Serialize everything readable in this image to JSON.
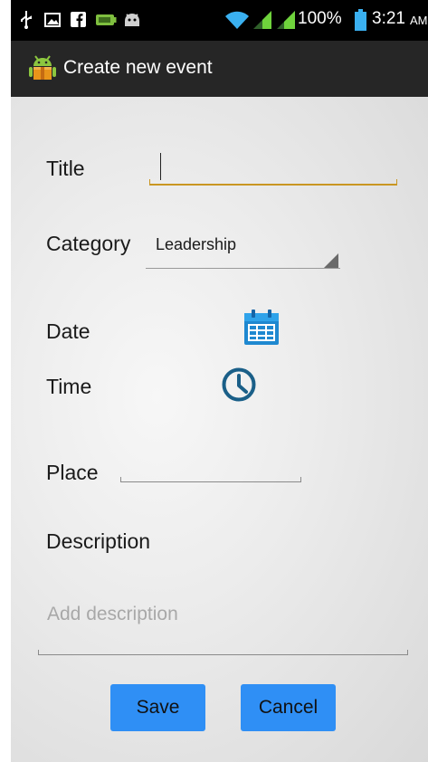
{
  "status_bar": {
    "battery_percent": "100%",
    "time": "3:21",
    "ampm": "AM",
    "icons": [
      "usb-icon",
      "gallery-icon",
      "facebook-icon",
      "battery-saver-icon",
      "android-icon",
      "wifi-icon",
      "signal-icon",
      "signal-icon",
      "battery-icon"
    ]
  },
  "action_bar": {
    "title": "Create new event",
    "icon": "android-app-icon"
  },
  "form": {
    "title_label": "Title",
    "title_value": "",
    "category_label": "Category",
    "category_value": "Leadership",
    "date_label": "Date",
    "date_icon": "calendar-icon",
    "time_label": "Time",
    "time_icon": "clock-icon",
    "place_label": "Place",
    "place_value": "",
    "description_label": "Description",
    "description_placeholder": "Add description"
  },
  "buttons": {
    "save_label": "Save",
    "cancel_label": "Cancel"
  },
  "colors": {
    "status_bar": "#000000",
    "action_bar": "#262626",
    "accent_focus": "#c99622",
    "button": "#2f8ff5",
    "icon_blue": "#1e88d0"
  }
}
